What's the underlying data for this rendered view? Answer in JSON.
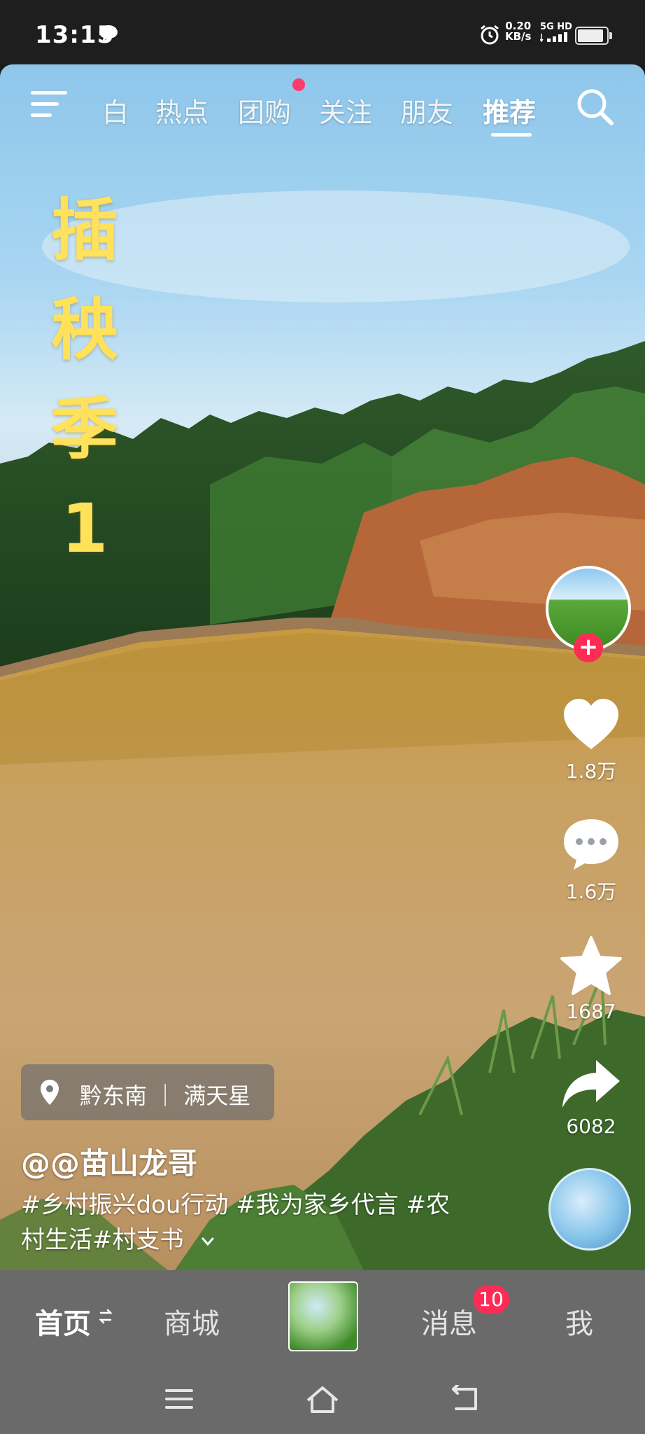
{
  "status_bar": {
    "time": "13:15",
    "speed_value": "0.20",
    "speed_unit": "KB/s",
    "network_label": "5G HD"
  },
  "top_tabs": [
    {
      "label": "白"
    },
    {
      "label": "热点"
    },
    {
      "label": "团购"
    },
    {
      "label": "关注"
    },
    {
      "label": "朋友"
    },
    {
      "label": "推荐"
    }
  ],
  "active_tab": "推荐",
  "video": {
    "overlay_title": "插\n秧\n季\n1",
    "location": "黔东南 ｜ 满天星",
    "author": "@@苗山龙哥",
    "description": "#乡村振兴dou行动 #我为家乡代言 #农村生活#村支书"
  },
  "actions": {
    "likes": "1.8万",
    "comments": "1.6万",
    "favorites": "1687",
    "shares": "6082"
  },
  "bottom_tabs": {
    "home": "首页",
    "mall": "商城",
    "messages": "消息",
    "messages_badge": "10",
    "me": "我"
  },
  "colors": {
    "accent_red": "#fe2c55",
    "title_yellow": "#ffe25a",
    "tabbar_gray": "#6a6a6a"
  }
}
